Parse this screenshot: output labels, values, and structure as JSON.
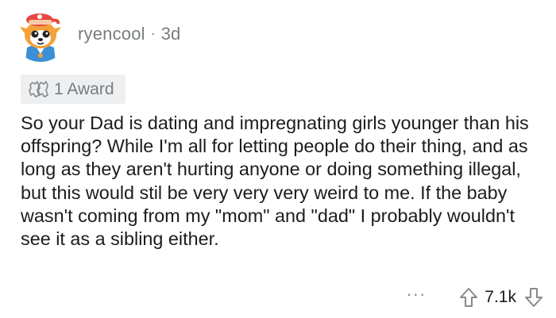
{
  "comment": {
    "username": "ryencool",
    "separator": "·",
    "age": "3d",
    "award": {
      "icon": "award-icon",
      "label": "1 Award"
    },
    "body": "So your Dad is dating and impregnating girls younger than his offspring? While I'm all for letting people do their thing, and as long as they aren't hurting anyone or doing something illegal, but this would stil be very very very weird to me. If the baby wasn't coming from my \"mom\" and \"dad\" I probably wouldn't see it as a sibling either.",
    "actions": {
      "more_label": "···",
      "score": "7.1k",
      "upvote_icon": "upvote-arrow-icon",
      "downvote_icon": "downvote-arrow-icon"
    }
  },
  "colors": {
    "meta_text": "#787c7e",
    "award_bg": "#edeff1",
    "body_text": "#1c1c1c",
    "avatar_orange": "#f4a13a",
    "avatar_blue": "#3b8fd6"
  }
}
